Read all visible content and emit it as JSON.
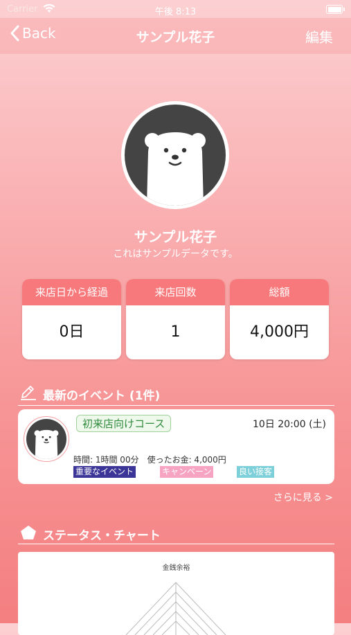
{
  "status_bar": {
    "carrier": "Carrier",
    "time": "午後 8:13"
  },
  "nav": {
    "back_label": "Back",
    "title": "サンプル花子",
    "edit_label": "編集"
  },
  "profile": {
    "name": "サンプル花子",
    "description": "これはサンプルデータです。"
  },
  "stats": [
    {
      "label": "来店日から経過",
      "value": "0日"
    },
    {
      "label": "来店回数",
      "value": "1"
    },
    {
      "label": "総額",
      "value": "4,000円"
    }
  ],
  "events_section": {
    "title": "最新のイベント (1件)"
  },
  "event": {
    "course": "初来店向けコース",
    "date": "10日 20:00 (土)",
    "details": "時間: 1時間 00分　使ったお金: 4,000円",
    "tags": [
      {
        "label": "重要なイベント",
        "color": "#3a3597"
      },
      {
        "label": "キャンペーン",
        "color": "#f6a4c2"
      },
      {
        "label": "良い接客",
        "color": "#7dd0d9"
      }
    ]
  },
  "see_more": "さらに見る >",
  "chart_section": {
    "title": "ステータス・チャート"
  },
  "chart": {
    "axis_label_top": "金銭余裕"
  },
  "colors": {
    "accent": "#f7797b",
    "dark": "#444444"
  }
}
